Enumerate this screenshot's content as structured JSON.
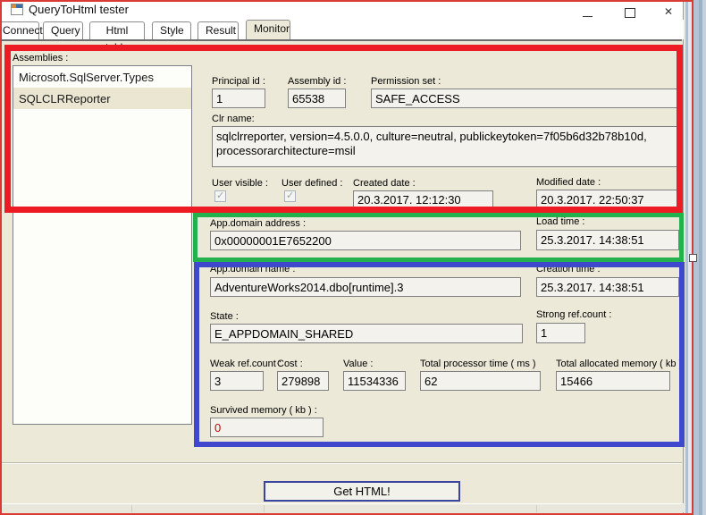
{
  "window": {
    "title": "QueryToHtml tester"
  },
  "tabs": [
    {
      "label": "Connect"
    },
    {
      "label": "Query"
    },
    {
      "label": "Html table"
    },
    {
      "label": "Style"
    },
    {
      "label": "Result"
    },
    {
      "label": "Monitor"
    }
  ],
  "selected_tab": "Monitor",
  "assemblies": {
    "label": "Assemblies :",
    "items": [
      {
        "name": "Microsoft.SqlServer.Types",
        "selected": false
      },
      {
        "name": "SQLCLRReporter",
        "selected": true
      }
    ]
  },
  "fields": {
    "principal_id": {
      "label": "Principal id :",
      "value": "1"
    },
    "assembly_id": {
      "label": "Assembly id :",
      "value": "65538"
    },
    "permission_set": {
      "label": "Permission set :",
      "value": "SAFE_ACCESS"
    },
    "clr_name": {
      "label": "Clr name:",
      "value": "sqlclrreporter, version=4.5.0.0, culture=neutral, publickeytoken=7f05b6d32b78b10d, processorarchitecture=msil"
    },
    "user_visible": {
      "label": "User visible :",
      "checked": true
    },
    "user_defined": {
      "label": "User defined :",
      "checked": true
    },
    "created_date": {
      "label": "Created date :",
      "value": "20.3.2017. 12:12:30"
    },
    "modified_date": {
      "label": "Modified date :",
      "value": "20.3.2017. 22:50:37"
    },
    "appdomain_address": {
      "label": "App.domain address :",
      "value": "0x00000001E7652200"
    },
    "load_time": {
      "label": "Load time :",
      "value": "25.3.2017. 14:38:51"
    },
    "appdomain_name": {
      "label": "App.domain name :",
      "value": "AdventureWorks2014.dbo[runtime].3"
    },
    "creation_time": {
      "label": "Creation time :",
      "value": "25.3.2017. 14:38:51"
    },
    "state": {
      "label": "State :",
      "value": "E_APPDOMAIN_SHARED"
    },
    "strong_ref_count": {
      "label": "Strong ref.count :",
      "value": "1"
    },
    "weak_ref_count": {
      "label": "Weak ref.count :",
      "value": "3"
    },
    "cost": {
      "label": "Cost :",
      "value": "279898"
    },
    "value": {
      "label": "Value :",
      "value": "11534336"
    },
    "total_processor_time": {
      "label": "Total processor time ( ms )",
      "value": "62"
    },
    "total_allocated_memory": {
      "label": "Total allocated memory ( kb )",
      "value": "15466"
    },
    "survived_memory": {
      "label": "Survived memory ( kb ) :",
      "value": "0"
    }
  },
  "actions": {
    "get_html": "Get HTML!"
  },
  "colors": {
    "annotation_red": "#ed1c24",
    "annotation_green": "#22b14c",
    "annotation_blue": "#3f48cc",
    "survived_memory_text": "#cc0000",
    "form_background": "#ece9d8"
  }
}
